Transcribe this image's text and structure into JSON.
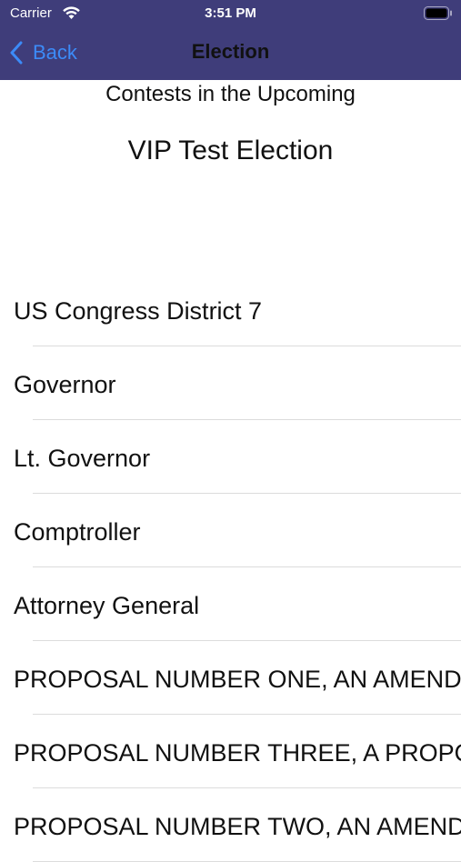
{
  "status_bar": {
    "carrier": "Carrier",
    "time": "3:51 PM"
  },
  "nav": {
    "back_label": "Back",
    "title": "Election"
  },
  "header": {
    "line1": "Contests in the Upcoming",
    "line2": "VIP Test Election"
  },
  "contests": [
    {
      "label": "US Congress District 7"
    },
    {
      "label": "Governor"
    },
    {
      "label": "Lt. Governor"
    },
    {
      "label": "Comptroller"
    },
    {
      "label": "Attorney General"
    },
    {
      "label": "PROPOSAL NUMBER ONE, AN AMEND"
    },
    {
      "label": "PROPOSAL NUMBER THREE, A PROPO"
    },
    {
      "label": "PROPOSAL NUMBER TWO, AN AMEND"
    }
  ],
  "colors": {
    "nav_bg": "#3f3d7a",
    "link": "#3c8bf8"
  }
}
